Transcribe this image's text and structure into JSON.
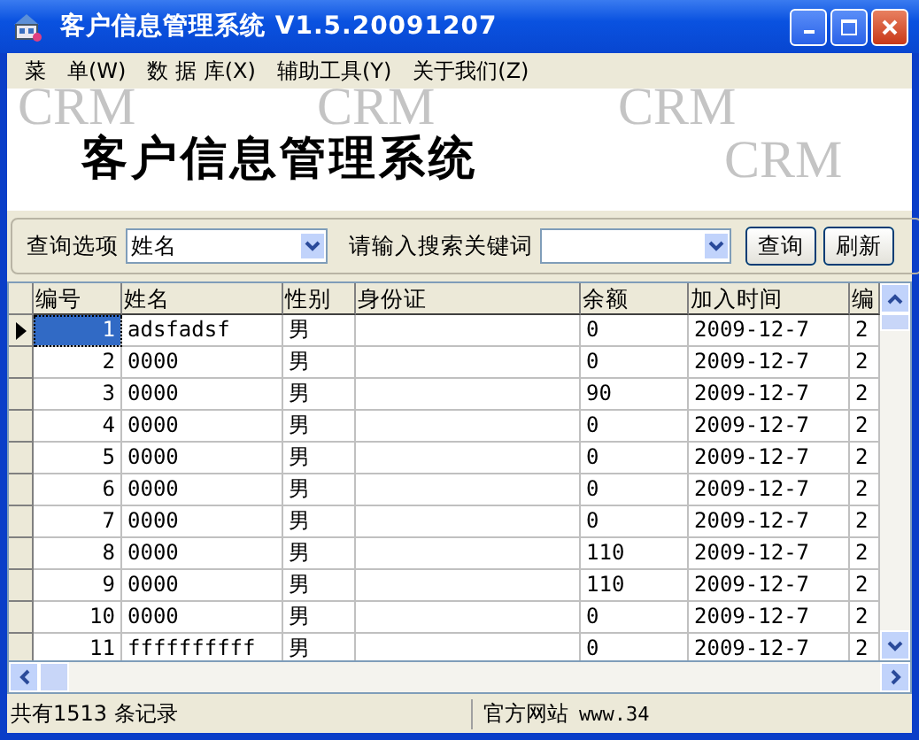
{
  "window": {
    "title": "客户信息管理系统 V1.5.20091207"
  },
  "menu": [
    {
      "label": "菜　单(W)"
    },
    {
      "label": "数 据 库(X)"
    },
    {
      "label": "辅助工具(Y)"
    },
    {
      "label": "关于我们(Z)"
    }
  ],
  "banner": {
    "title": "客户信息管理系统",
    "marks": [
      "CRM",
      "CRM",
      "CRM",
      "CRM"
    ]
  },
  "search": {
    "option_label": "查询选项",
    "option_value": "姓名",
    "keyword_label": "请输入搜索关键词",
    "buttons": [
      "查询",
      "刷新"
    ]
  },
  "table": {
    "columns": [
      "编号",
      "姓名",
      "性别",
      "身份证",
      "余额",
      "加入时间",
      "编"
    ],
    "rows": [
      {
        "selected": true,
        "cells": [
          "1",
          "adsfadsf",
          "男",
          "",
          "0",
          "2009-12-7",
          "2"
        ]
      },
      {
        "selected": false,
        "cells": [
          "2",
          "0000",
          "男",
          "",
          "0",
          "2009-12-7",
          "2"
        ]
      },
      {
        "selected": false,
        "cells": [
          "3",
          "0000",
          "男",
          "",
          "90",
          "2009-12-7",
          "2"
        ]
      },
      {
        "selected": false,
        "cells": [
          "4",
          "0000",
          "男",
          "",
          "0",
          "2009-12-7",
          "2"
        ]
      },
      {
        "selected": false,
        "cells": [
          "5",
          "0000",
          "男",
          "",
          "0",
          "2009-12-7",
          "2"
        ]
      },
      {
        "selected": false,
        "cells": [
          "6",
          "0000",
          "男",
          "",
          "0",
          "2009-12-7",
          "2"
        ]
      },
      {
        "selected": false,
        "cells": [
          "7",
          "0000",
          "男",
          "",
          "0",
          "2009-12-7",
          "2"
        ]
      },
      {
        "selected": false,
        "cells": [
          "8",
          "0000",
          "男",
          "",
          "110",
          "2009-12-7",
          "2"
        ]
      },
      {
        "selected": false,
        "cells": [
          "9",
          "0000",
          "男",
          "",
          "110",
          "2009-12-7",
          "2"
        ]
      },
      {
        "selected": false,
        "cells": [
          "10",
          "0000",
          "男",
          "",
          "0",
          "2009-12-7",
          "2"
        ]
      },
      {
        "selected": false,
        "cells": [
          "11",
          "ffffffffff",
          "男",
          "",
          "0",
          "2009-12-7",
          "2"
        ]
      }
    ]
  },
  "status_bar": {
    "count": "共有1513 条记录",
    "site_label": "官方网站",
    "site_url": "www.34"
  }
}
